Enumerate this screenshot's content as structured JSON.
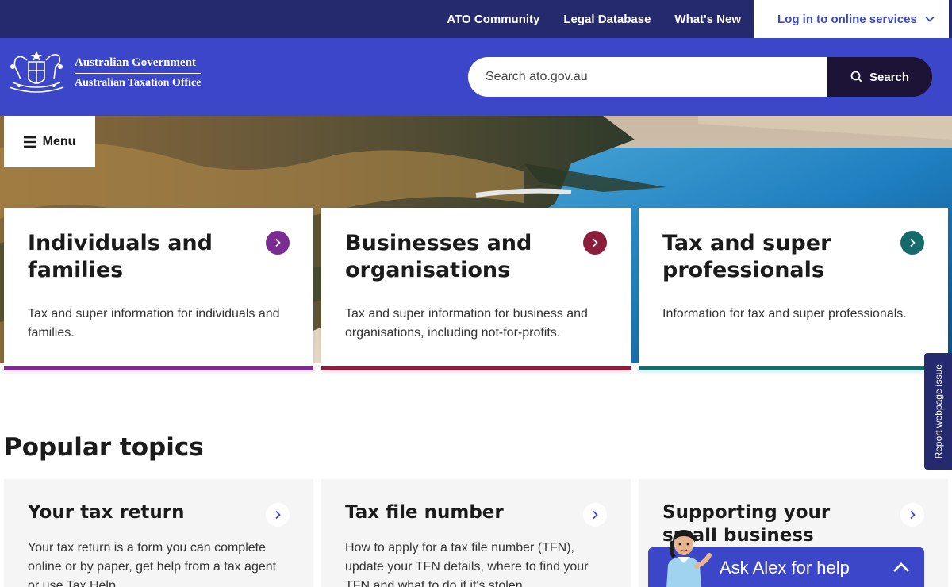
{
  "topbar": {
    "links": [
      "ATO Community",
      "Legal Database",
      "What's New"
    ],
    "login_label": "Log in to online services"
  },
  "header": {
    "logo_line1": "Australian Government",
    "logo_line2": "Australian Taxation Office",
    "search_placeholder": "Search ato.gov.au",
    "search_button": "Search"
  },
  "menu_label": "Menu",
  "audience_cards": [
    {
      "title": "Individuals and families",
      "text": "Tax and super information for individuals and families.",
      "accent": "#7b2c93"
    },
    {
      "title": "Businesses and organisations",
      "text": "Tax and super information for business and organisations, including not-for-profits.",
      "accent": "#8a1e3c"
    },
    {
      "title": "Tax and super professionals",
      "text": "Information for tax and super professionals.",
      "accent": "#156a6a"
    }
  ],
  "popular": {
    "heading": "Popular topics",
    "cards": [
      {
        "title": "Your tax return",
        "text": "Your tax return is a form you can complete online or by paper, get help from a tax agent or use Tax Help."
      },
      {
        "title": "Tax file number",
        "text": "How to apply for a tax file number (TFN), update your TFN details, where to find your TFN and what to do if it's stolen."
      },
      {
        "title": "Supporting your small business",
        "text": ""
      }
    ]
  },
  "report_tab": "Report webpage issue",
  "alex_label": "Ask Alex for help",
  "colors": {
    "topbar": "#252a6e",
    "header": "#3b47c8",
    "search_button": "#1d1336"
  }
}
